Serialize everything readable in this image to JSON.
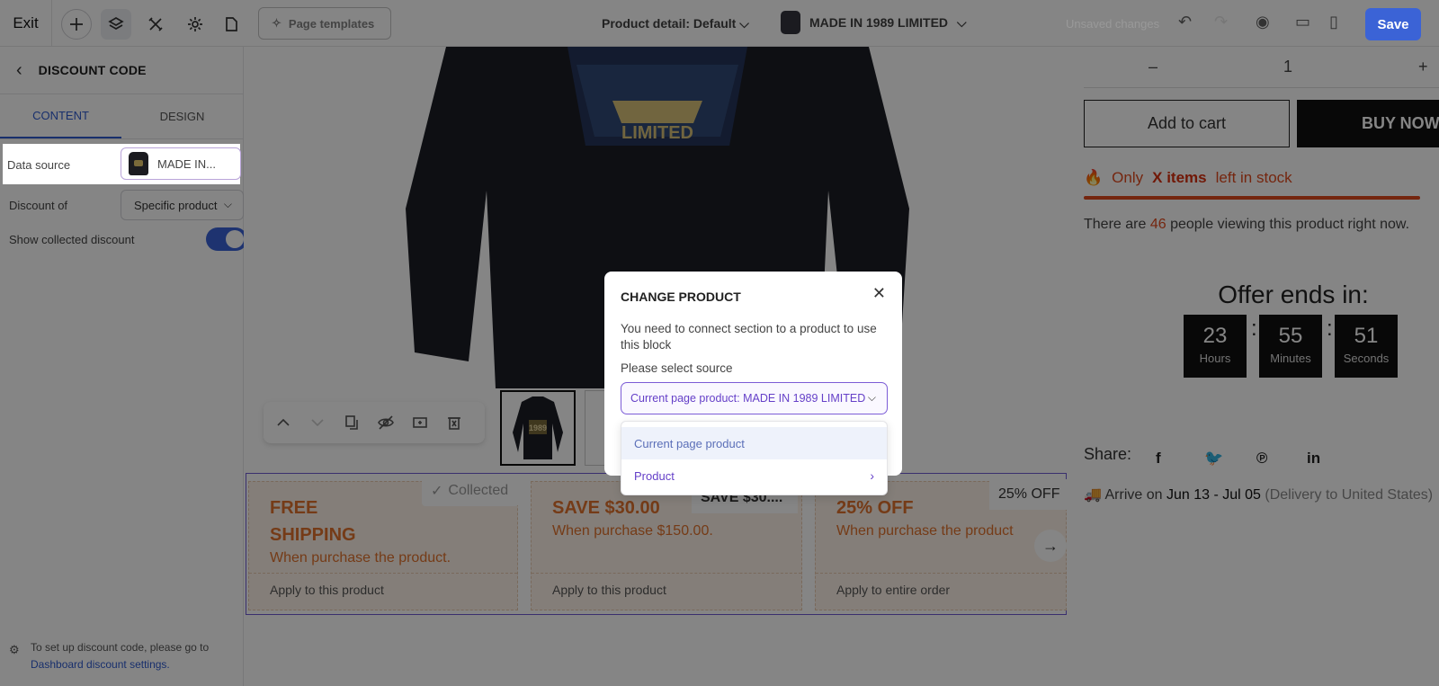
{
  "topbar": {
    "exit_label": "Exit",
    "page_templates_label": "Page templates",
    "page_selector_label": "Product detail: Default",
    "product_selector_label": "MADE IN 1989 LIMITED",
    "unsaved_label": "Unsaved changes",
    "save_label": "Save"
  },
  "panel": {
    "title": "DISCOUNT CODE",
    "tabs": [
      "CONTENT",
      "DESIGN"
    ],
    "data_source_label": "Data source",
    "data_source_value": "MADE IN...",
    "discount_of_label": "Discount of",
    "discount_of_value": "Specific product",
    "show_collected_label": "Show collected discount",
    "show_collected_on": true,
    "footer_text": "To set up discount code, please go to",
    "footer_link": "Dashboard discount settings."
  },
  "product": {
    "quantity": "1",
    "qty_minus": "–",
    "qty_plus": "+",
    "add_to_cart": "Add to cart",
    "buy_now": "BUY NOW",
    "stock_prefix": "Only",
    "stock_highlight": "X items",
    "stock_suffix": "left in stock",
    "viewing_prefix": "There are",
    "viewing_count": "46",
    "viewing_suffix": "people viewing this product right now.",
    "offer_title": "Offer ends in:",
    "countdown": [
      {
        "value": "23",
        "unit": "Hours"
      },
      {
        "value": "55",
        "unit": "Minutes"
      },
      {
        "value": "51",
        "unit": "Seconds"
      }
    ],
    "share_label": "Share:",
    "arrive_prefix": "Arrive on",
    "arrive_dates": "Jun 13 - Jul 05",
    "arrive_suffix": "(Delivery to United States)",
    "hoodie_text": "LIMITED",
    "thumb_text": "1989"
  },
  "discounts": {
    "collected_label": "Collected",
    "save_tag": "SAVE $30....",
    "off_tag": "25% OFF",
    "cards": [
      {
        "title": "FREE SHIPPING",
        "subtitle": "When purchase the product.",
        "apply": "Apply to this product"
      },
      {
        "title": "SAVE $30.00",
        "subtitle": "When purchase $150.00.",
        "apply": "Apply to this product"
      },
      {
        "title": "25% OFF",
        "subtitle": "When purchase the product",
        "apply": "Apply to entire order"
      }
    ]
  },
  "modal": {
    "title": "CHANGE PRODUCT",
    "message": "You need to connect section to a product to use this block",
    "source_label": "Please select source",
    "selected_source": "Current page product: MADE IN 1989 LIMITED",
    "options": [
      "Current page product",
      "Product"
    ]
  },
  "colors": {
    "accent": "#3b63d6",
    "select_purple": "#7c5cd6",
    "discount_orange": "#e0712c",
    "stock_red": "#e04a1e"
  }
}
